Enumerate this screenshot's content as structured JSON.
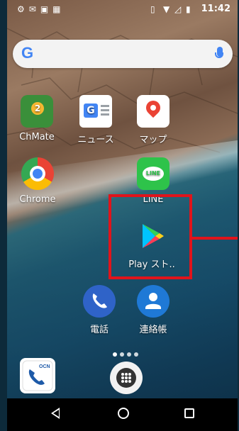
{
  "status_bar": {
    "time": "11:42",
    "notification_icons": [
      "usb-debug-icon",
      "cat-icon",
      "mail-icon",
      "gallery-icon",
      "keyboard-icon"
    ],
    "system_icons": [
      "vibrate-icon",
      "wifi-icon",
      "no-signal-icon",
      "battery-icon"
    ]
  },
  "search": {
    "logo": "G",
    "mic": "mic-icon"
  },
  "apps": [
    {
      "label": "ChMate"
    },
    {
      "label": "ニュース"
    },
    {
      "label": "マップ"
    },
    {
      "label": "Chrome"
    },
    {
      "label": "LINE"
    },
    {
      "label": "Play スト.."
    },
    {
      "label": "電話"
    },
    {
      "label": "連絡帳"
    }
  ],
  "dock": {
    "ocn_label": "OCN",
    "drawer": "app-drawer-icon"
  },
  "highlight": {
    "target": "Play スト..",
    "color": "#e0141b"
  },
  "page_dots": 4,
  "nav": {
    "back": "back-icon",
    "home": "home-icon",
    "recent": "recent-apps-icon"
  }
}
